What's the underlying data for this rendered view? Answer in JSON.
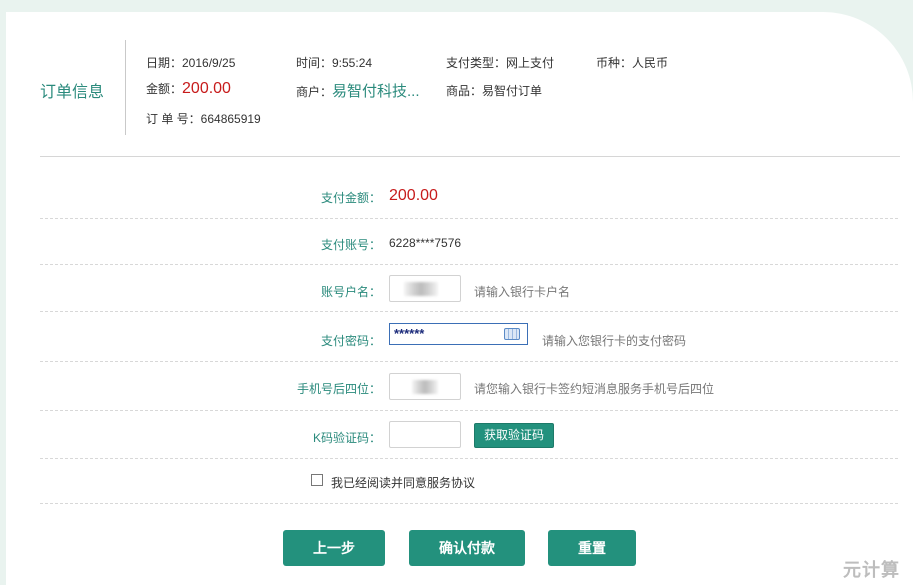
{
  "order": {
    "title": "订单信息",
    "date": "日期：2016/9/25",
    "time": "时间：9:55:24",
    "pay_type": "支付类型：网上支付",
    "currency": "币种：人民币",
    "amount_label": "金额：",
    "amount_value": "200.00",
    "merchant_label": "商户：",
    "merchant_value": "易智付科技...",
    "goods": "商品：易智付订单",
    "order_no": "订 单 号：664865919"
  },
  "form": {
    "pay_amount_label": "支付金额：",
    "pay_amount_value": "200.00",
    "account_label": "支付账号：",
    "account_value": "6228****7576",
    "holder_label": "账号户名：",
    "holder_hint": "请输入银行卡户名",
    "password_label": "支付密码：",
    "password_value": "******",
    "password_hint": "请输入您银行卡的支付密码",
    "phone_label": "手机号后四位：",
    "phone_hint": "请您输入银行卡签约短消息服务手机号后四位",
    "kcode_label": "K码验证码：",
    "get_code_label": "获取验证码",
    "agree_label": "我已经阅读并同意服务协议"
  },
  "buttons": {
    "prev": "上一步",
    "confirm": "确认付款",
    "reset": "重置"
  },
  "watermark": "元计算",
  "colors": {
    "accent": "#23917d",
    "amount": "#c71b1b",
    "label": "#2a8a7c"
  }
}
